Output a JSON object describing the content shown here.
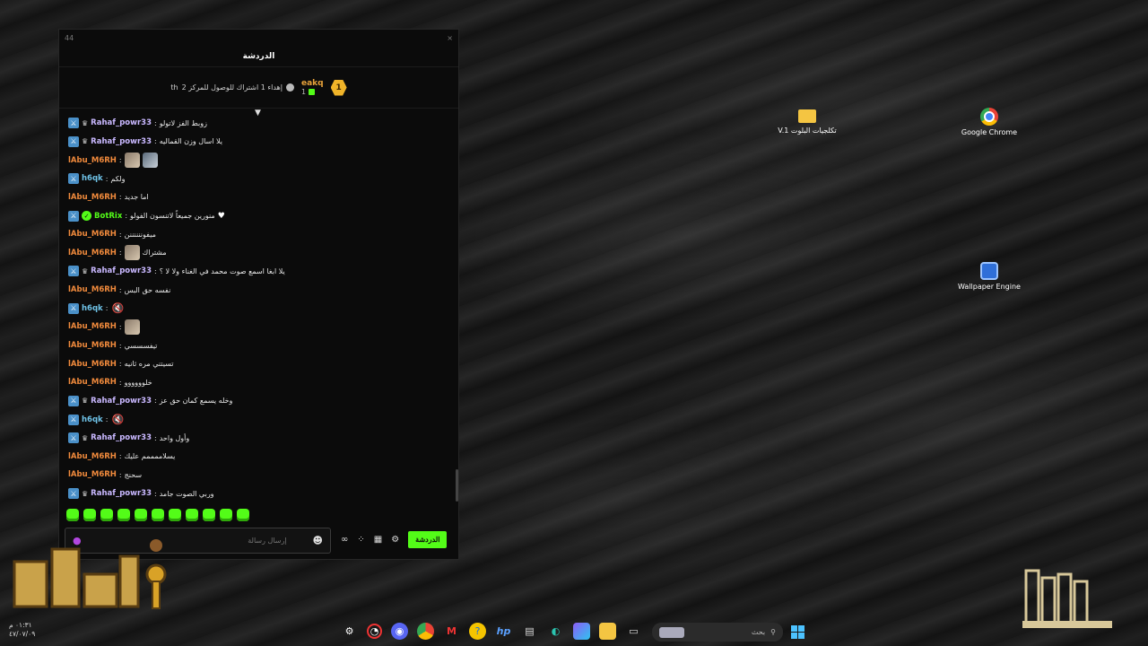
{
  "window": {
    "titlebar_label": "44",
    "close_label": "×",
    "chat_title": "الدردشة"
  },
  "pinned": {
    "text": "إهداء 1 اشتراك للوصول للمركز 2",
    "suffix": "th",
    "rank": "1",
    "username": "eakq",
    "gift_count": "1"
  },
  "messages": [
    {
      "user": "Rahaf_powr33",
      "mod": true,
      "crown": true,
      "text": "زوبط الفز لاتولو"
    },
    {
      "user": "Rahaf_powr33",
      "mod": true,
      "crown": true,
      "text": "يلا اسال وزن القماليه"
    },
    {
      "user": "lAbu_M6RH",
      "text": "",
      "emotes": [
        "image",
        "image"
      ]
    },
    {
      "user": "h6qk",
      "mod": true,
      "text": "ولكم"
    },
    {
      "user": "lAbu_M6RH",
      "text": "اما جديد"
    },
    {
      "user": "BotRix",
      "mod": true,
      "verified": true,
      "text": "منورين جميعاً لاتنسون الفولو",
      "heart": true
    },
    {
      "user": "lAbu_M6RH",
      "text": "ميفوننننننن"
    },
    {
      "user": "lAbu_M6RH",
      "text": "مشتراك",
      "emotes": [
        "image"
      ]
    },
    {
      "user": "Rahaf_powr33",
      "mod": true,
      "crown": true,
      "text": "يلا ابغا اسمع صوت محمد في الغناء ولا لا ؟"
    },
    {
      "user": "lAbu_M6RH",
      "text": "نفسه حق البس"
    },
    {
      "user": "h6qk",
      "mod": true,
      "text": "",
      "emotes": [
        "mute"
      ]
    },
    {
      "user": "lAbu_M6RH",
      "text": "",
      "emotes": [
        "image"
      ]
    },
    {
      "user": "lAbu_M6RH",
      "text": "تيفسسسي"
    },
    {
      "user": "lAbu_M6RH",
      "text": "تسيتني مره ثانيه"
    },
    {
      "user": "lAbu_M6RH",
      "text": "خلوووووو"
    },
    {
      "user": "Rahaf_powr33",
      "mod": true,
      "crown": true,
      "text": "وخله يسمع كمان حق عز"
    },
    {
      "user": "h6qk",
      "mod": true,
      "text": "",
      "emotes": [
        "mute"
      ]
    },
    {
      "user": "Rahaf_powr33",
      "mod": true,
      "crown": true,
      "text": "وأول واحد"
    },
    {
      "user": "lAbu_M6RH",
      "text": "يسلاممممم عليك"
    },
    {
      "user": "lAbu_M6RH",
      "text": "سحنج"
    },
    {
      "user": "Rahaf_powr33",
      "mod": true,
      "crown": true,
      "text": "وربي الصوت جامد"
    }
  ],
  "input": {
    "placeholder": "إرسال رسالة"
  },
  "actions": {
    "chat_button": "الدردشة"
  },
  "desktop_icons": [
    {
      "label": "تكلجيات البلوت V.1",
      "icon": "folder-icon"
    },
    {
      "label": "Google Chrome",
      "icon": "chrome-icon"
    },
    {
      "label": "Wallpaper Engine",
      "icon": "wallpaper-engine-icon"
    }
  ],
  "taskbar": {
    "search_label": "بحث",
    "clock_time": "٠١:٣١ م",
    "clock_date": "٤٧/٠٧/٠٩"
  },
  "colors": {
    "accent": "#53fc18",
    "rahaf": "#c9b8ff",
    "abu": "#f08a3c",
    "h6qk": "#6fc3e8"
  }
}
